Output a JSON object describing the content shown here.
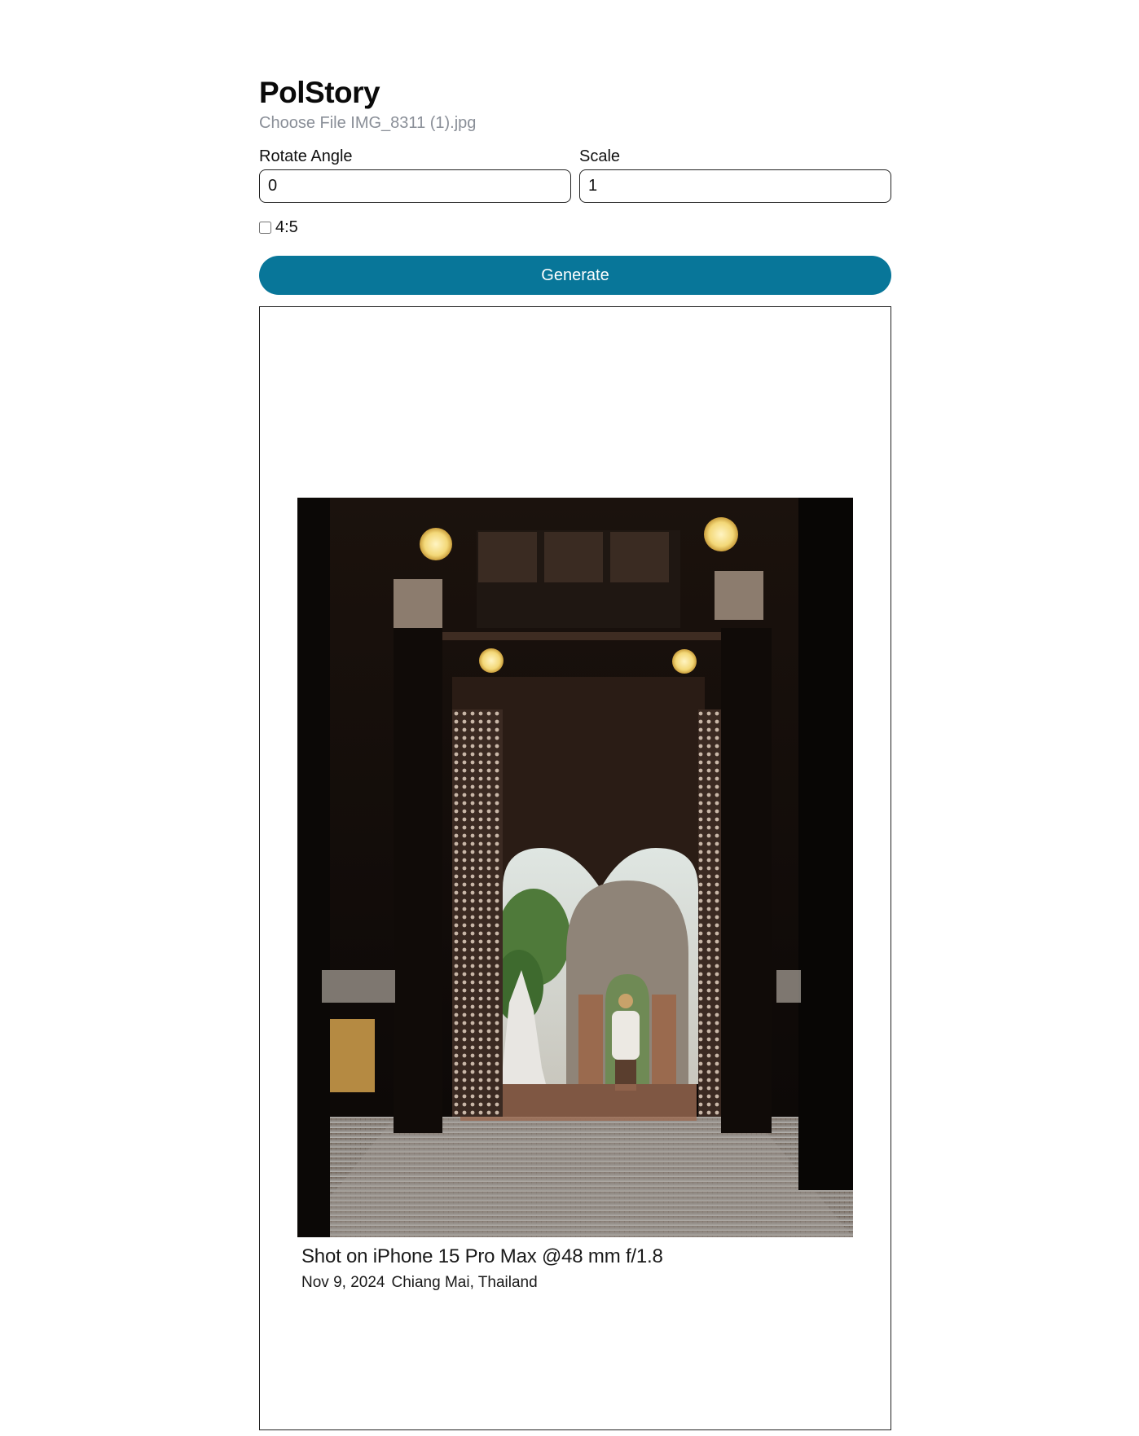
{
  "app": {
    "title": "PolStory"
  },
  "file_input": {
    "button_label": "Choose File",
    "file_name": "IMG_8311 (1).jpg"
  },
  "fields": {
    "rotate": {
      "label": "Rotate Angle",
      "value": "0"
    },
    "scale": {
      "label": "Scale",
      "value": "1"
    }
  },
  "ratio_option": {
    "label": "4:5",
    "checked": false
  },
  "generate": {
    "label": "Generate"
  },
  "polaroid": {
    "caption_main": "Shot on iPhone 15 Pro Max @48 mm f/1.8",
    "date": "Nov 9, 2024",
    "location": "Chiang Mai, Thailand"
  },
  "colors": {
    "accent": "#087699",
    "border": "#222222",
    "muted_text": "#8a8f98"
  }
}
